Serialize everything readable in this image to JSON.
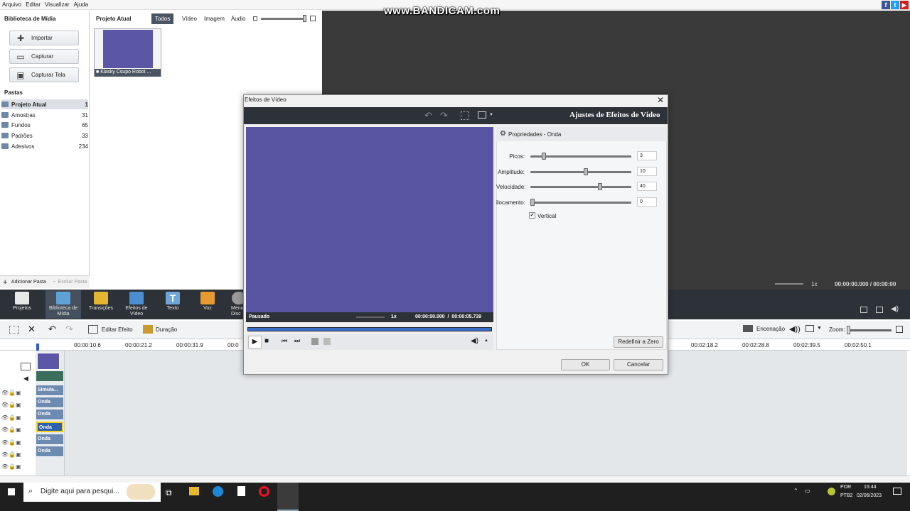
{
  "menu": [
    "Arquivo",
    "Editar",
    "Visualizar",
    "Ajuda"
  ],
  "watermark": "www.BANDICAM.com",
  "library": {
    "title": "Biblioteca de Mídia",
    "buttons": [
      {
        "label": "Importar",
        "icon": "plus-icon"
      },
      {
        "label": "Capturar",
        "icon": "camera-icon"
      },
      {
        "label": "Capturar Tela",
        "icon": "monitor-icon"
      }
    ],
    "folders_title": "Pastas",
    "folders": [
      {
        "name": "Projeto Atual",
        "count": "1"
      },
      {
        "name": "Amostras",
        "count": "31"
      },
      {
        "name": "Fundos",
        "count": "65"
      },
      {
        "name": "Padrões",
        "count": "33"
      },
      {
        "name": "Adesivos",
        "count": "234"
      }
    ],
    "add_folder": "Adicionar Pasta",
    "delete_folder": "Excluir Pasta"
  },
  "project": {
    "title": "Projeto Atual",
    "tabs": [
      "Todos",
      "Vídeo",
      "Imagem",
      "Áudio"
    ],
    "clip_name": "Klasky Csupo Robot ..."
  },
  "preview": {
    "speed": "1x",
    "time": "00:00:00.000 / 00:00:00"
  },
  "toolbar": [
    {
      "label": "Projetos",
      "icon": "clapper-icon"
    },
    {
      "label": "Biblioteca de Mídia",
      "icon": "library-icon"
    },
    {
      "label": "Transições",
      "icon": "transition-icon"
    },
    {
      "label": "Efeitos de Vídeo",
      "icon": "star-film-icon"
    },
    {
      "label": "Texto",
      "icon": "text-icon"
    },
    {
      "label": "Voz",
      "icon": "microphone-icon"
    },
    {
      "label": "Menu Disc",
      "icon": "disc-icon"
    }
  ],
  "editbar": {
    "edit_effect": "Editar Efeito",
    "duration": "Duração",
    "staging": "Encenação",
    "zoom": "Zoom:"
  },
  "timeline": {
    "ticks": [
      "00:00:10.6",
      "00:00:21.2",
      "00:00:31.9",
      "00:0",
      "00:02:18.2",
      "00:02:28.8",
      "00:02:39.5",
      "00:02:50.1"
    ],
    "clips": [
      "Simula...",
      "Onda",
      "Onda",
      "Onda",
      "Onda",
      "Onda"
    ]
  },
  "dialog": {
    "title": "Efeitos de Vídeo",
    "heading": "Ajustes de Efeitos de Vídeo",
    "status": "Pausado",
    "speed": "1x",
    "time": "00:00:00.000  /  00:00:05.739",
    "properties_title": "Propriedades - Onda",
    "params": [
      {
        "label": "Picos:",
        "value": "3",
        "level": 0.12
      },
      {
        "label": "Amplitude:",
        "value": "10",
        "level": 0.55
      },
      {
        "label": "Velocidade:",
        "value": "40",
        "level": 0.7
      },
      {
        "label": "ilocamento:",
        "value": "0",
        "level": 0.0
      }
    ],
    "vertical_label": "Vertical",
    "vertical_checked": "✔",
    "reset": "Redefinir a Zero",
    "ok": "OK",
    "cancel": "Cancelar"
  },
  "taskbar": {
    "search_placeholder": "Digite aqui para pesqui...",
    "lang": "POR",
    "layout": "PTB2",
    "time": "15:44",
    "date": "02/06/2023"
  },
  "colors": {
    "accent": "#3a6cc8",
    "dark": "#2d3238",
    "video": "#5a55a2"
  }
}
